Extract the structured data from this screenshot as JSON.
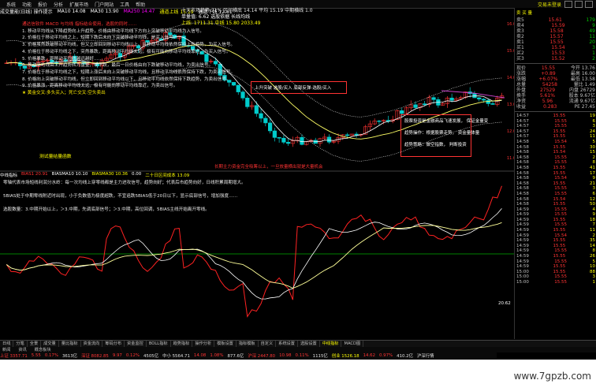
{
  "menubar": {
    "items": [
      "系统",
      "功能",
      "报价",
      "分析",
      "扩展市场",
      "门户网站",
      "工具",
      "帮助"
    ],
    "right": "交易未登录"
  },
  "top_info": {
    "title": "成交量能(日线) 操作提示",
    "ma10": "MA10 14.08",
    "ma30": "MA30 13.90",
    "ma250": "MA250 14.47",
    "tip": "通道上线 15.19",
    "tip2": "通道下线 12.61"
  },
  "mid_info": {
    "line1": "十天市场趋势 71%  区间横底 14.14  平均 15.19  中期横线 1.0",
    "line2": "单量值: 6.62 选股依据  长线均线",
    "line3": "上线: 1711.31  中线 15.80 2033.49"
  },
  "notes": [
    {
      "text": "通达信软件 MACD 与均线 指标结合使用，选股的同时……",
      "cls": "red"
    },
    {
      "text": "1. 移动平均线从下降趋势向上升趋势，价格由移动平均线下方向上突破移动平均线为入信号。",
      "cls": ""
    },
    {
      "text": "2. 价格位于移动平均线之上，短期下跌后未向下突破移动平均线，是买入信号。",
      "cls": ""
    },
    {
      "text": "3. 价格虽然跌破移动平均线，但又立即回到移动平均线以上，且移动平均线依然保持上升趋势，为买入信号。",
      "cls": ""
    },
    {
      "text": "4. 价格位于移动平均线之下，突然暴跌，距离移动平均线太远，极有可能向移动平均线靠近，为买入信号。",
      "cls": ""
    },
    {
      "text": "5. 价格暴跌，距移动平均线越远越好……",
      "cls": ""
    },
    {
      "text": "6. 移动平均线由上升趋势转为盘整，或下跌，最后一日价格由向下跌破移动平均线，为卖出信号。",
      "cls": ""
    },
    {
      "text": "7. 价格位于移动平均线之下，短期上涨后未向上突破移动平均线，且移动平均线依然保持下跌，为卖出信号。",
      "cls": ""
    },
    {
      "text": "8. 价格向上突破移动平均线，但立即回到移动平均线以下，且移动平均线依然保持下跌趋势，为卖出信号。",
      "cls": ""
    },
    {
      "text": "9. 价格暴涨，距离移动平均线太远，极有可能向移动平均线靠近，为卖出信号。",
      "cls": ""
    },
    {
      "text": "★ 黄金交叉:多头买入；死亡交叉:空头卖出",
      "cls": "yl"
    }
  ],
  "box1": "上升突破 选股/买入   底部反弹-选股/买入",
  "box2": [
    "股票投资是金融商品飞速发展，   保证金量变",
    "趋势操作：根据股票走势，   资金量体量",
    "趋势策略：做空指数，   判断投资"
  ],
  "bottom_left_txt": "测试量结量函数",
  "bottom_mid_txt": "长期主力资金完全吸筹以上，一旦放量横出就是大量机会",
  "ind_head": {
    "a": "中线指标",
    "b": "BIAS1 20.91",
    "c": "BIASMA10 10.10",
    "d": "BIASMA30 10.36",
    "e": "0.00",
    "f": "二十日区间成本 13.09"
  },
  "ind_notes": [
    "零轴代表市场短线利润分水岭：每一次均线上穿零线都是主力进攻信号，趋势向好；代表后市趋势向好，日线积累周期增大。",
    "5BIAS处于中期零线附近时出现，小于负数值为极度超跌，不宜追跌5BIAS低于20日以下，显示底部信号，增加强度……",
    "选股数量：3.中期开始以上，＞3.中期，先调底部信号；＞3.中期，高位回调，5BIAS主线开始离开零线。"
  ],
  "right_panel": {
    "header": "卖 买 量",
    "orderbook": [
      {
        "l": "卖5",
        "v": "15.61",
        "c": "179"
      },
      {
        "l": "卖4",
        "v": "15.59",
        "c": "9"
      },
      {
        "l": "卖3",
        "v": "15.58",
        "c": "49"
      },
      {
        "l": "卖2",
        "v": "15.57",
        "c": "11"
      },
      {
        "l": "卖1",
        "v": "15.55",
        "c": "20"
      },
      {
        "l": "买1",
        "v": "15.54",
        "c": "3"
      },
      {
        "l": "买2",
        "v": "15.53",
        "c": "1"
      },
      {
        "l": "买3",
        "v": "15.52",
        "c": "2"
      }
    ],
    "stats": [
      {
        "l": "现价",
        "v": "15.55",
        "c": "今开 13.76"
      },
      {
        "l": "涨跌",
        "v": "+0.89",
        "c": "最高 16.00"
      },
      {
        "l": "涨幅",
        "v": "+6.07%",
        "c": "最低 13.58"
      },
      {
        "l": "总量",
        "v": "54258",
        "c": "量比 1.49"
      },
      {
        "l": "外盘",
        "v": "27529",
        "c": "内盘 26729"
      },
      {
        "l": "换手",
        "v": "5.61%",
        "c": "股本 9.67亿"
      },
      {
        "l": "净资",
        "v": "5.96",
        "c": "流通 9.67亿"
      },
      {
        "l": "收益",
        "v": "0.283",
        "c": "PE 27.45"
      }
    ],
    "quotes": [
      {
        "t": "14:57",
        "p": "15.55",
        "n": "19"
      },
      {
        "t": "14:57",
        "p": "15.55",
        "n": "6"
      },
      {
        "t": "14:57",
        "p": "15.55",
        "n": "3"
      },
      {
        "t": "14:57",
        "p": "15.55",
        "n": "24"
      },
      {
        "t": "14:57",
        "p": "15.55",
        "n": "11"
      },
      {
        "t": "14:58",
        "p": "15.54",
        "n": "5"
      },
      {
        "t": "14:58",
        "p": "15.55",
        "n": "30"
      },
      {
        "t": "14:58",
        "p": "15.54",
        "n": "15"
      },
      {
        "t": "14:58",
        "p": "15.55",
        "n": "2"
      },
      {
        "t": "14:58",
        "p": "15.55",
        "n": "8"
      },
      {
        "t": "14:58",
        "p": "15.55",
        "n": "41"
      },
      {
        "t": "14:58",
        "p": "15.55",
        "n": "17"
      },
      {
        "t": "14:58",
        "p": "15.54",
        "n": "9"
      },
      {
        "t": "14:58",
        "p": "15.55",
        "n": "21"
      },
      {
        "t": "14:58",
        "p": "15.55",
        "n": "3"
      },
      {
        "t": "14:58",
        "p": "15.55",
        "n": "6"
      },
      {
        "t": "14:58",
        "p": "15.54",
        "n": "12"
      },
      {
        "t": "14:58",
        "p": "15.55",
        "n": "50"
      },
      {
        "t": "14:59",
        "p": "15.55",
        "n": "4"
      },
      {
        "t": "14:59",
        "p": "15.55",
        "n": "9"
      },
      {
        "t": "14:59",
        "p": "15.55",
        "n": "18"
      },
      {
        "t": "14:59",
        "p": "15.55",
        "n": "7"
      },
      {
        "t": "14:59",
        "p": "15.55",
        "n": "11"
      },
      {
        "t": "14:59",
        "p": "15.54",
        "n": "2"
      },
      {
        "t": "14:59",
        "p": "15.55",
        "n": "35"
      },
      {
        "t": "14:59",
        "p": "15.55",
        "n": "14"
      },
      {
        "t": "14:59",
        "p": "15.55",
        "n": "8"
      },
      {
        "t": "14:59",
        "p": "15.55",
        "n": "26"
      },
      {
        "t": "14:59",
        "p": "15.55",
        "n": "5"
      },
      {
        "t": "14:59",
        "p": "15.55",
        "n": "10"
      },
      {
        "t": "15:00",
        "p": "15.55",
        "n": "88"
      },
      {
        "t": "15:00",
        "p": "15.55",
        "n": "3"
      },
      {
        "t": "15:00",
        "p": "15.55",
        "n": "1"
      }
    ]
  },
  "price_labels": [
    "16.00",
    "15.00",
    "14.00",
    "13.00",
    "12.00",
    "11.00"
  ],
  "ind_labels": [
    "20.62"
  ],
  "tabs": [
    "日线",
    "分笔",
    "全景",
    "成交量",
    "量比指标",
    "资金流向",
    "筹码分布",
    "资金监控",
    "BOLL指标",
    "趋势指标",
    "操作分析",
    "模板设置",
    "指标模板",
    "自定义",
    "系统设置",
    "选股设置",
    "中线指标",
    "MACD图"
  ],
  "tabs_active_index": 16,
  "tabs2": [
    "新闻",
    "资讯",
    "概念板块"
  ],
  "status": [
    {
      "t": "上证 3357.71",
      "c": "r"
    },
    {
      "t": "5.55",
      "c": "r"
    },
    {
      "t": "0.17%",
      "c": "r"
    },
    {
      "t": "3613亿",
      "c": "w"
    },
    {
      "t": "深证 8082.85",
      "c": "r"
    },
    {
      "t": "9.97",
      "c": "r"
    },
    {
      "t": "0.12%",
      "c": "r"
    },
    {
      "t": "4505亿",
      "c": "w"
    },
    {
      "t": "中小 5564.71",
      "c": "w"
    },
    {
      "t": "14.08",
      "c": "r"
    },
    {
      "t": "1.08%",
      "c": "r"
    },
    {
      "t": "877.6亿",
      "c": "w"
    },
    {
      "t": "沪深 2447.80",
      "c": "r"
    },
    {
      "t": "10.98",
      "c": "r"
    },
    {
      "t": "0.11%",
      "c": "r"
    },
    {
      "t": "1115亿",
      "c": "w"
    },
    {
      "t": "创业 1526.18",
      "c": "y"
    },
    {
      "t": "14.62",
      "c": "r"
    },
    {
      "t": "0.97%",
      "c": "r"
    },
    {
      "t": "410.2亿",
      "c": "w"
    },
    {
      "t": "沪深行情",
      "c": "w"
    }
  ],
  "watermark": "www.7gpzb.com",
  "colors": {
    "up": "#ff3333",
    "down": "#00cccc",
    "ma_white": "#ffffff",
    "ma_yellow": "#ffff66",
    "ma_purple": "#cc44cc",
    "band": "#d8d8d8"
  }
}
